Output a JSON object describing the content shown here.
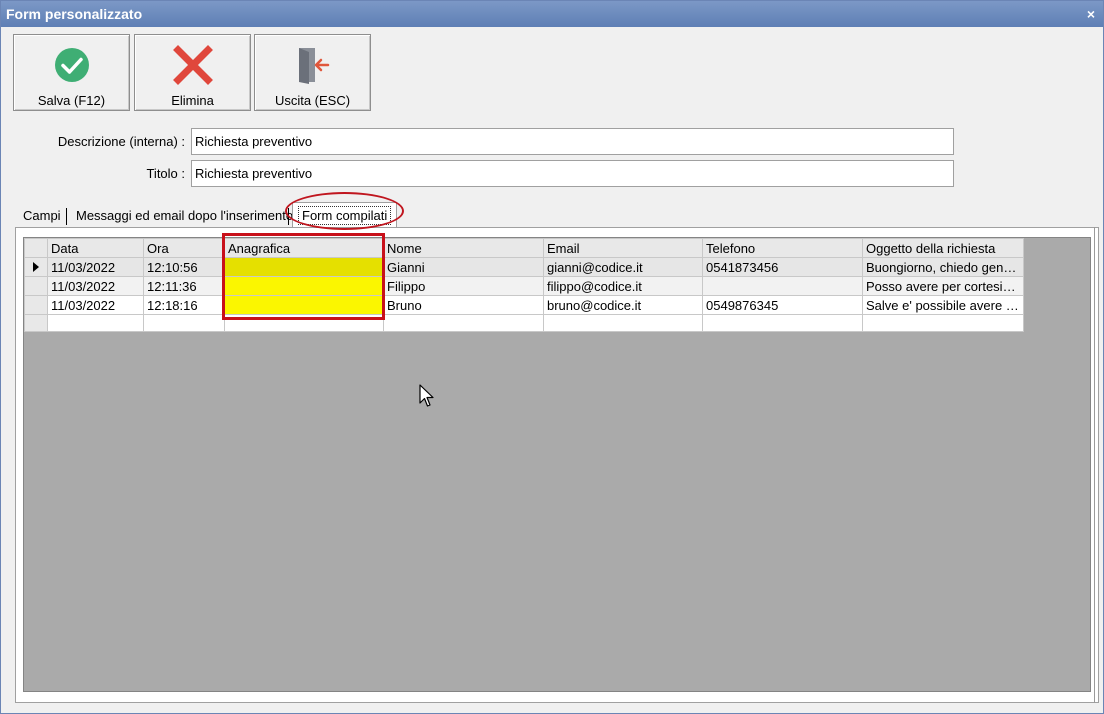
{
  "window": {
    "title": "Form personalizzato",
    "close_glyph": "×"
  },
  "toolbar": {
    "save_label": "Salva (F12)",
    "save_icon": "check-circle-icon",
    "save_color": "#3fae74",
    "delete_label": "Elimina",
    "delete_icon": "x-icon",
    "delete_color": "#e0473c",
    "exit_label": "Uscita (ESC)",
    "exit_icon": "exit-door-icon"
  },
  "form": {
    "description_label": "Descrizione (interna) :",
    "description_value": "Richiesta preventivo",
    "title_label": "Titolo :",
    "title_value": "Richiesta preventivo"
  },
  "tabs": [
    {
      "label": "Campi"
    },
    {
      "label": "Messaggi ed email dopo l'inserimento"
    },
    {
      "label": "Form compilati"
    }
  ],
  "active_tab": "Form compilati",
  "grid": {
    "columns": [
      "Data",
      "Ora",
      "Anagrafica",
      "Nome",
      "Email",
      "Telefono",
      "Oggetto della richiesta"
    ],
    "rows": [
      {
        "data": "11/03/2022",
        "ora": "12:10:56",
        "anagrafica": "",
        "nome": "Gianni",
        "email": "gianni@codice.it",
        "telefono": "0541873456",
        "oggetto": "Buongiorno, chiedo gen…"
      },
      {
        "data": "11/03/2022",
        "ora": "12:11:36",
        "anagrafica": "",
        "nome": "Filippo",
        "email": "filippo@codice.it",
        "telefono": "",
        "oggetto": "Posso avere per cortesi…"
      },
      {
        "data": "11/03/2022",
        "ora": "12:18:16",
        "anagrafica": "",
        "nome": "Bruno",
        "email": "bruno@codice.it",
        "telefono": "0549876345",
        "oggetto": "Salve e' possibile avere …"
      }
    ],
    "highlight_color": "#fbf600",
    "annotation_color": "#c8101a"
  }
}
